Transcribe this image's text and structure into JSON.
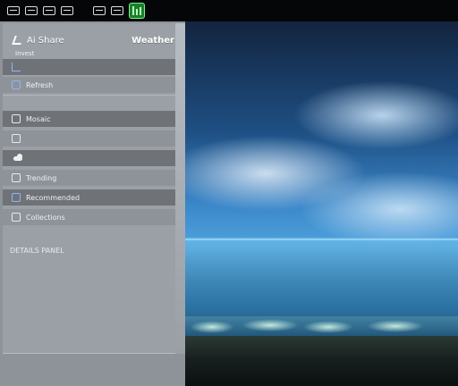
{
  "topbar": {
    "items": [
      {
        "label": "",
        "icon": "window-icon"
      },
      {
        "label": "",
        "icon": "menu-icon"
      },
      {
        "label": "",
        "icon": "apps-icon"
      },
      {
        "label": "",
        "icon": "tasks-icon"
      },
      {
        "label": "",
        "icon": "system-icon"
      },
      {
        "label": "",
        "icon": "status-icon"
      },
      {
        "label": "",
        "icon": "active-app-icon"
      }
    ]
  },
  "panel": {
    "header_left": "Ai Share",
    "header_right": "Weather",
    "subheader": "Invest",
    "rows": [
      {
        "label": "",
        "icon": "bracket-icon"
      },
      {
        "label": "Refresh",
        "icon": "file-icon"
      },
      {
        "label": "Mosaic",
        "icon": "folder-icon"
      },
      {
        "label": "",
        "icon": "book-icon"
      },
      {
        "label": "",
        "icon": "cloud-icon"
      },
      {
        "label": "Trending",
        "icon": "chart-icon"
      },
      {
        "label": "Recommended",
        "icon": "star-icon"
      },
      {
        "label": "Collections",
        "icon": "grid-icon"
      }
    ],
    "footer": "DETAILS PANEL"
  },
  "colors": {
    "panel_bg": "#9aa0a6",
    "row_dark": "#6f7378",
    "topbar": "#050608",
    "active_green": "#1b7f2a"
  }
}
